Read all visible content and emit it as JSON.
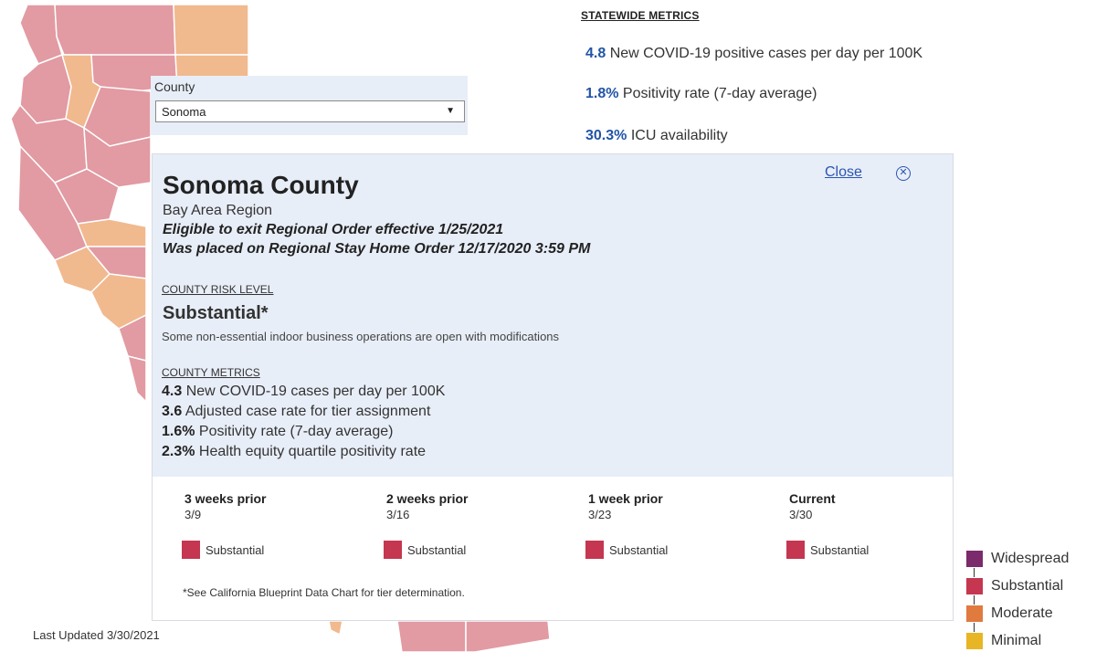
{
  "colors": {
    "accent_blue": "#2154a6",
    "widespread": "#7b2a6b",
    "substantial": "#c53650",
    "moderate": "#e07a3e",
    "minimal": "#e8b524",
    "map_substantial_fill": "#e29aa3",
    "map_moderate_fill": "#f1b98e"
  },
  "statewide": {
    "heading": "STATEWIDE METRICS",
    "metrics": [
      {
        "value": "4.8",
        "label": "New COVID-19 positive cases per day per 100K"
      },
      {
        "value": "1.8%",
        "label": "Positivity rate (7-day average)"
      },
      {
        "value": "30.3%",
        "label": "ICU availability"
      }
    ]
  },
  "county_select": {
    "label": "County",
    "selected": "Sonoma",
    "caret_icon": "chevron-down-icon"
  },
  "popup": {
    "title": "Sonoma County",
    "region": "Bay Area Region",
    "line1": "Eligible to exit Regional Order effective 1/25/2021",
    "line2": "Was placed on Regional Stay Home Order 12/17/2020 3:59 PM",
    "close_label": "Close",
    "close_icon": "close-circle-icon",
    "risk_heading": "COUNTY RISK LEVEL",
    "risk_level": "Substantial*",
    "risk_description": "Some non-essential indoor business operations are open with modifications",
    "metrics_heading": "COUNTY METRICS",
    "metrics": [
      {
        "value": "4.3",
        "label": " New COVID-19 cases per day per 100K"
      },
      {
        "value": "3.6",
        "label": " Adjusted case rate for tier assignment"
      },
      {
        "value": "1.6%",
        "label": " Positivity rate (7-day average)"
      },
      {
        "value": "2.3%",
        "label": " Health equity quartile positivity rate"
      }
    ],
    "weeks": [
      {
        "heading": "3 weeks prior",
        "date": "3/9",
        "tier": "Substantial"
      },
      {
        "heading": "2 weeks prior",
        "date": "3/16",
        "tier": "Substantial"
      },
      {
        "heading": "1 week prior",
        "date": "3/23",
        "tier": "Substantial"
      },
      {
        "heading": "Current",
        "date": "3/30",
        "tier": "Substantial"
      }
    ],
    "footnote": "*See California Blueprint Data Chart for tier determination."
  },
  "last_updated": "Last Updated 3/30/2021",
  "legend": [
    {
      "label": "Widespread",
      "color": "#7b2a6b"
    },
    {
      "label": "Substantial",
      "color": "#c53650"
    },
    {
      "label": "Moderate",
      "color": "#e07a3e"
    },
    {
      "label": "Minimal",
      "color": "#e8b524"
    }
  ]
}
